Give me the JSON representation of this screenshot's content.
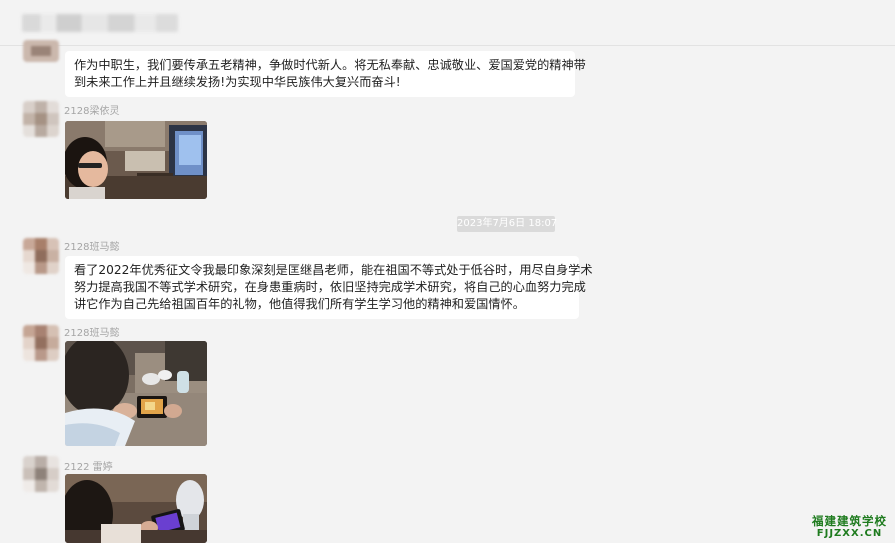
{
  "header": {
    "title": ""
  },
  "messages": [
    {
      "sender": "",
      "type": "text",
      "lines": [
        "作为中职生，我们要传承五老精神，争做时代新人。将无私奉献、忠诚敬业、爱国爱党的精神带",
        "到未来工作上并且继续发扬!为实现中华民族伟大复兴而奋斗!"
      ]
    },
    {
      "sender": "2128梁依灵",
      "type": "image",
      "image_name": "student-at-desk-photo"
    },
    {
      "timestamp": "2023年7月6日 18:07"
    },
    {
      "sender": "2128班马懿",
      "type": "text",
      "lines": [
        "看了2022年优秀征文令我最印象深刻是匡继昌老师，能在祖国不等式处于低谷时，用尽自身学术",
        "努力提高我国不等式学术研究，在身患重病时，依旧坚持完成学术研究，将自己的心血努力完成",
        "讲它作为自己先给祖国百年的礼物，他值得我们所有学生学习他的精神和爱国情怀。"
      ]
    },
    {
      "sender": "2128班马懿",
      "type": "image",
      "image_name": "student-watching-phone-photo"
    },
    {
      "sender": "2122 雷婷",
      "type": "image",
      "image_name": "student-holding-phone-photo"
    }
  ],
  "watermark": {
    "name": "福建建筑学校",
    "url": "FJJZXX.CN"
  },
  "colors": {
    "background": "#f3f3f3",
    "bubble": "#ffffff",
    "sender_text": "#a5a5a5",
    "timestamp_bg": "#dadada",
    "watermark": "#1e7b1e"
  }
}
